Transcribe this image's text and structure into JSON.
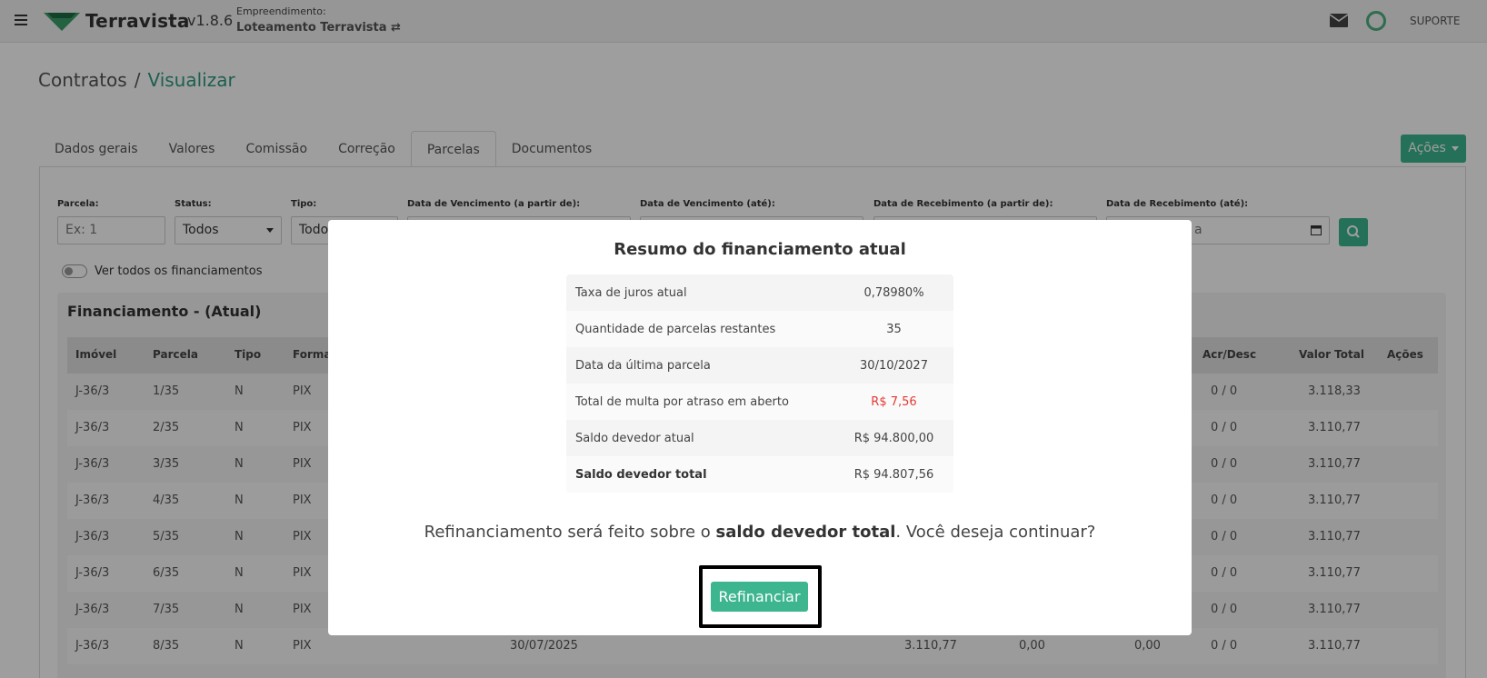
{
  "topbar": {
    "brand": "Terravista",
    "version": "v1.8.6",
    "emp_label": "Empreendimento:",
    "emp_name": "Loteamento Terravista ⇄",
    "support": "SUPORTE",
    "accent_color": "#3db58f"
  },
  "breadcrumb": {
    "parent": "Contratos",
    "separator": "/",
    "current": "Visualizar"
  },
  "tabs": [
    {
      "label": "Dados gerais"
    },
    {
      "label": "Valores"
    },
    {
      "label": "Comissão"
    },
    {
      "label": "Correção"
    },
    {
      "label": "Parcelas",
      "active": true
    },
    {
      "label": "Documentos"
    }
  ],
  "actions_label": "Ações",
  "filters": {
    "parcela": {
      "label": "Parcela:",
      "placeholder": "Ex: 1"
    },
    "status": {
      "label": "Status:",
      "value": "Todos"
    },
    "tipo": {
      "label": "Tipo:",
      "value": "Todo"
    },
    "venc_de": {
      "label": "Data de Vencimento (a partir de):"
    },
    "venc_ate": {
      "label": "Data de Vencimento (até):"
    },
    "receb_de": {
      "label": "Data de Recebimento (a partir de):"
    },
    "receb_ate": {
      "label": "Data de Recebimento (até):",
      "value": "a"
    }
  },
  "toggle_label": "Ver todos os financiamentos",
  "financing_title": "Financiamento - (Atual)",
  "grid": {
    "headers": {
      "imovel": "Imóvel",
      "parcela": "Parcela",
      "tipo": "Tipo",
      "forma": "Forma",
      "acr": "Acr/Desc",
      "total": "Valor Total",
      "acoes": "Ações"
    },
    "rows": [
      {
        "imovel": "J-36/3",
        "parcela": "1/35",
        "tipo": "N",
        "forma": "PIX",
        "acr": "0 / 0",
        "total": "3.118,33"
      },
      {
        "imovel": "J-36/3",
        "parcela": "2/35",
        "tipo": "N",
        "forma": "PIX",
        "acr": "0 / 0",
        "total": "3.110,77"
      },
      {
        "imovel": "J-36/3",
        "parcela": "3/35",
        "tipo": "N",
        "forma": "PIX",
        "acr": "0 / 0",
        "total": "3.110,77"
      },
      {
        "imovel": "J-36/3",
        "parcela": "4/35",
        "tipo": "N",
        "forma": "PIX",
        "acr": "0 / 0",
        "total": "3.110,77"
      },
      {
        "imovel": "J-36/3",
        "parcela": "5/35",
        "tipo": "N",
        "forma": "PIX",
        "acr": "0 / 0",
        "total": "3.110,77"
      },
      {
        "imovel": "J-36/3",
        "parcela": "6/35",
        "tipo": "N",
        "forma": "PIX",
        "acr": "0 / 0",
        "total": "3.110,77"
      },
      {
        "imovel": "J-36/3",
        "parcela": "7/35",
        "tipo": "N",
        "forma": "PIX",
        "acr": "0 / 0",
        "total": "3.110,77"
      },
      {
        "imovel": "J-36/3",
        "parcela": "8/35",
        "tipo": "N",
        "forma": "PIX",
        "vencimento": "30/07/2025",
        "valor": "3.110,77",
        "c1": "0,00",
        "c2": "0,00",
        "acr": "0 / 0",
        "total": "3.110,77"
      }
    ]
  },
  "modal": {
    "title": "Resumo do financiamento atual",
    "summary": [
      {
        "label": "Taxa de juros atual",
        "value": "0,78980%"
      },
      {
        "label": "Quantidade de parcelas restantes",
        "value": "35"
      },
      {
        "label": "Data da última parcela",
        "value": "30/10/2027"
      },
      {
        "label": "Total de multa por atraso em aberto",
        "value": "R$ 7,56"
      },
      {
        "label": "Saldo devedor atual",
        "value": "R$ 94.800,00"
      },
      {
        "label": "Saldo devedor total",
        "value": "R$ 94.807,56"
      }
    ],
    "question_pre": "Refinanciamento será feito sobre o ",
    "question_bold": "saldo devedor total",
    "question_post": ". Você deseja continuar?",
    "button_label": "Refinanciar"
  }
}
